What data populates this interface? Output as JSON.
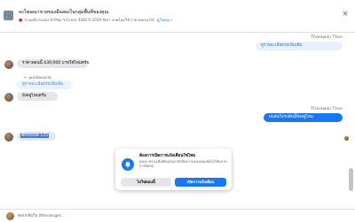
{
  "header": {
    "title": "ลงโฆษณาขายของมือสองในกลุ่มพื้นที่ของคุณ",
    "meta": "ส่วนหนึ่ง Isuzu D-Max V-Cross 4WD ปี 2019 สีเทา รถพร้อมใช้ ราคาต่อรองได้",
    "link": "ดูโฆษณา",
    "close": "×"
  },
  "messages": {
    "sender1": "Tharawan Thon",
    "out1": "ดูรายละเอียดรถเพิ่มเติม",
    "in1": "ราคาตอนนี้ 439,000 บาทใช่ไหมครับ",
    "reply_note": "คุณได้ตอบกลับ",
    "reply_quote": "ดูรายละเอียดรถเพิ่มเติม",
    "in2": "ยังอยู่ไหมครับ",
    "sender2": "Tharawan Thon",
    "out2": "ผมสนใจรถคันนี้ยังอยู่ไหม",
    "in3_selected": "ซื้อรถยนต์ 125"
  },
  "popup": {
    "title": "ต้องการเปิดการแจ้งเตือนใช่ไหม",
    "body": "คุณจะทราบเมื่อมีคนตอบกลับข้อความของคุณเพื่อไม่ให้พลาดการติดต่อ",
    "secondary_label": "ไม่ใช่ตอนนี้",
    "primary_label": "เปิดการแจ้งเตือน"
  },
  "composer": {
    "placeholder": "ตอบกลับใน Messenger..."
  },
  "colors": {
    "accent": "#1877f2",
    "bubble_in": "#e4e6eb"
  }
}
